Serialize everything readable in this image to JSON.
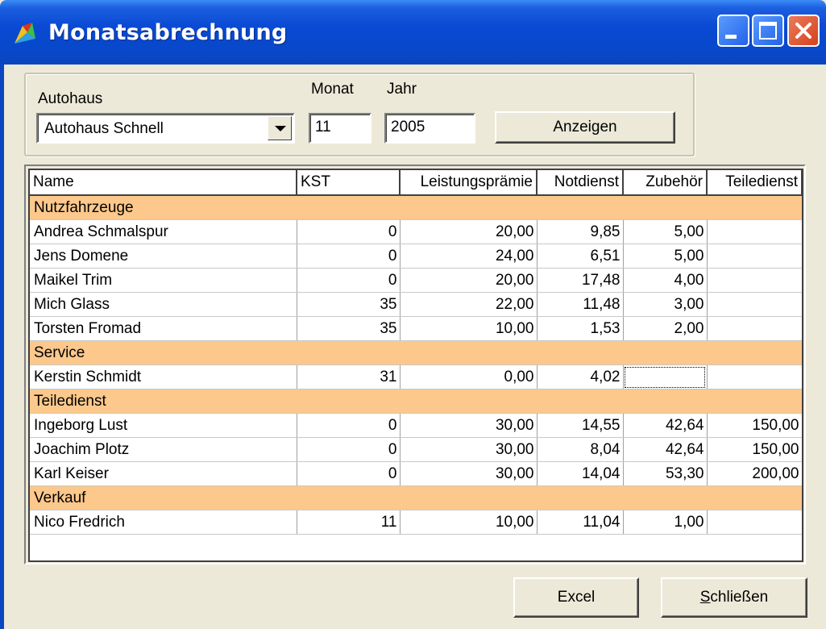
{
  "window": {
    "title": "Monatsabrechnung"
  },
  "filter": {
    "autohaus_label": "Autohaus",
    "autohaus_value": "Autohaus Schnell",
    "monat_label": "Monat",
    "monat_value": "11",
    "jahr_label": "Jahr",
    "jahr_value": "2005",
    "show_button": "Anzeigen"
  },
  "table": {
    "columns": [
      "Name",
      "KST",
      "Leistungsprämie",
      "Notdienst",
      "Zubehör",
      "Teiledienst"
    ],
    "rows": [
      {
        "group": "Nutzfahrzeuge"
      },
      {
        "cells": [
          "Andrea Schmalspur",
          "0",
          "20,00",
          "9,85",
          "5,00",
          ""
        ]
      },
      {
        "cells": [
          "Jens Domene",
          "0",
          "24,00",
          "6,51",
          "5,00",
          ""
        ]
      },
      {
        "cells": [
          "Maikel Trim",
          "0",
          "20,00",
          "17,48",
          "4,00",
          ""
        ]
      },
      {
        "cells": [
          "Mich Glass",
          "35",
          "22,00",
          "11,48",
          "3,00",
          ""
        ]
      },
      {
        "cells": [
          "Torsten Fromad",
          "35",
          "10,00",
          "1,53",
          "2,00",
          ""
        ]
      },
      {
        "group": "Service"
      },
      {
        "cells": [
          "Kerstin Schmidt",
          "31",
          "0,00",
          "4,02",
          "",
          ""
        ],
        "focus_col": 4
      },
      {
        "group": "Teiledienst"
      },
      {
        "cells": [
          "Ingeborg Lust",
          "0",
          "30,00",
          "14,55",
          "42,64",
          "150,00"
        ]
      },
      {
        "cells": [
          "Joachim Plotz",
          "0",
          "30,00",
          "8,04",
          "42,64",
          "150,00"
        ]
      },
      {
        "cells": [
          "Karl Keiser",
          "0",
          "30,00",
          "14,04",
          "53,30",
          "200,00"
        ]
      },
      {
        "group": "Verkauf"
      },
      {
        "cells": [
          "Nico Fredrich",
          "11",
          "10,00",
          "11,04",
          "1,00",
          ""
        ]
      }
    ]
  },
  "buttons": {
    "excel": "Excel",
    "close": "Schließen"
  },
  "colors": {
    "titlebar": "#0a4ad4",
    "group_row": "#fcc88c",
    "window_bg": "#ece9d8"
  },
  "icons": {
    "app": "app-icon",
    "minimize": "minimize-icon",
    "maximize": "maximize-icon",
    "close": "close-icon"
  }
}
